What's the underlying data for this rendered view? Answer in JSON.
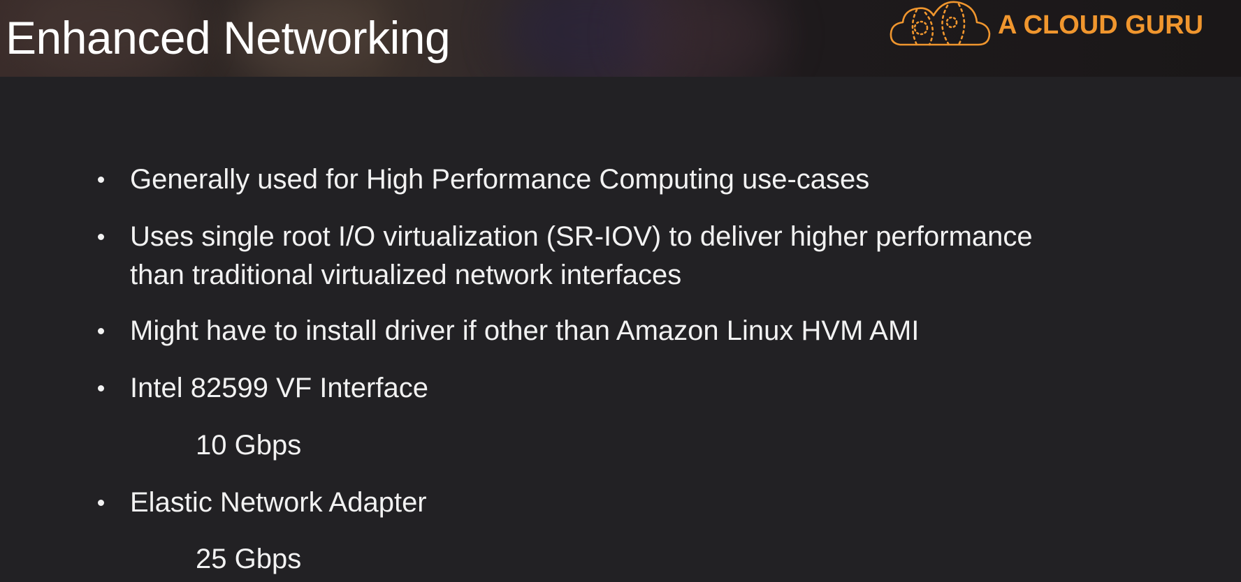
{
  "title": "Enhanced Networking",
  "logo": {
    "text": "A CLOUD GURU",
    "icon": "cloud-logo-icon",
    "color": "#f0962e"
  },
  "bullets": [
    {
      "text": "Generally used for High Performance Computing use-cases"
    },
    {
      "text": "Uses single root I/O virtualization (SR-IOV) to deliver higher performance",
      "continuation": "than traditional virtualized network interfaces"
    },
    {
      "text": "Might have to install driver if other than Amazon Linux HVM AMI"
    },
    {
      "text": "Intel 82599 VF Interface",
      "sub": "10 Gbps"
    },
    {
      "text": "Elastic Network Adapter",
      "sub": "25 Gbps"
    }
  ],
  "colors": {
    "background": "#222124",
    "text": "#f2f2f2",
    "accent": "#f0962e"
  }
}
